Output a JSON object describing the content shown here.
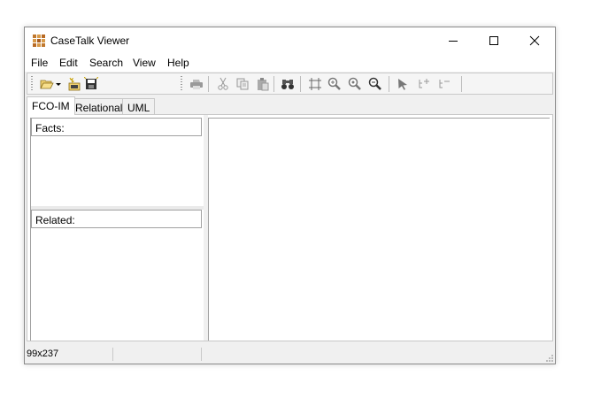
{
  "window": {
    "title": "CaseTalk Viewer",
    "icon": "app-grid-icon"
  },
  "window_controls": {
    "minimize": "minimize-icon",
    "maximize": "maximize-icon",
    "close": "close-icon"
  },
  "menu": {
    "items": [
      "File",
      "Edit",
      "Search",
      "View",
      "Help"
    ]
  },
  "toolbar": {
    "buttons": [
      "open-folder-icon",
      "dropdown-arrow-icon",
      "new-project-icon",
      "save-disk-icon",
      "print-icon",
      "cut-icon",
      "copy-icon",
      "paste-icon",
      "find-binoculars-icon",
      "fit-grid-icon",
      "zoom-in-icon",
      "zoom-reset-icon",
      "zoom-out-icon",
      "pointer-icon",
      "add-node-icon",
      "remove-node-icon"
    ]
  },
  "tabs": [
    "FCO-IM",
    "Relational",
    "UML"
  ],
  "active_tab": "FCO-IM",
  "panels": {
    "facts_label": "Facts:",
    "related_label": "Related:"
  },
  "status": {
    "size_text": "99x237"
  },
  "colors": {
    "accent_active": "#ffffff",
    "chrome": "#f0f0f0",
    "border": "#a0a0a0"
  }
}
